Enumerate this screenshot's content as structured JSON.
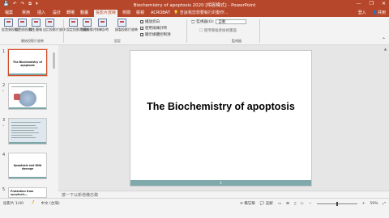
{
  "window": {
    "title": "Biochemistry of apoptosis 2020 [相容模式] - PowerPoint",
    "quick_access": [
      "💾",
      "↶",
      "↷",
      "⧉",
      "▾"
    ],
    "controls": [
      "—",
      "❐",
      "✕"
    ]
  },
  "tabs": [
    {
      "label": "檔案"
    },
    {
      "label": "常用"
    },
    {
      "label": "插入"
    },
    {
      "label": "設計"
    },
    {
      "label": "轉場"
    },
    {
      "label": "動畫"
    },
    {
      "label": "投影片放映",
      "active": true
    },
    {
      "label": "校閱"
    },
    {
      "label": "檢視"
    },
    {
      "label": "ACROBAT"
    }
  ],
  "tell_me": "告訴我您想要執行的動作...",
  "account": {
    "login": "登入",
    "share": "共用"
  },
  "ribbon": {
    "group1": {
      "label": "開始投影片放映",
      "buttons": [
        "從首張投影片",
        "從目前投影片",
        "線上簡報",
        "自訂投影片放映"
      ]
    },
    "group2": {
      "label": "設定",
      "buttons": [
        "設定投影片放映",
        "隱藏投影片",
        "排練計時",
        "錄製投影片放映"
      ],
      "checks": [
        {
          "label": "播放旁白",
          "checked": true
        },
        {
          "label": "使用排練計時",
          "checked": true
        },
        {
          "label": "顯示媒體控制項",
          "checked": true
        }
      ]
    },
    "group3": {
      "label": "監視器",
      "monitor_label": "監視器(O):",
      "monitor_value": "自動",
      "presenter_view": "使用簡報者檢視畫面"
    }
  },
  "slides": [
    {
      "num": "1",
      "title": "The Biochemistry of apoptosis",
      "selected": true
    },
    {
      "num": "2",
      "title": "",
      "star": "*"
    },
    {
      "num": "3",
      "title": "",
      "star": "*"
    },
    {
      "num": "4",
      "title": "Apoptosis and DNA damage"
    },
    {
      "num": "5",
      "title": "Protection from apoptosis"
    }
  ],
  "current_slide": {
    "title": "The Biochemistry of apoptosis",
    "page_number": "1"
  },
  "notes_placeholder": "按一下以新增備忘稿",
  "status": {
    "slide_info": "投影片 1/40",
    "language": "中文 (台灣)",
    "notes_button": "備忘稿",
    "comments_button": "註解",
    "zoom": "59%"
  },
  "colors": {
    "accent": "#b7472a",
    "slide_footer": "#7fa9aa"
  }
}
